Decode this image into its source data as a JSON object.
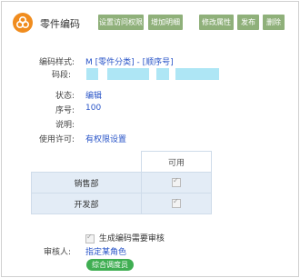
{
  "header": {
    "title": "零件编码",
    "buttons": [
      "设置访问权限",
      "增加明细",
      "修改属性",
      "发布",
      "删除"
    ]
  },
  "form": {
    "code_style_label": "编码样式:",
    "code_style_value": "M [零件分类] - [顺序号]",
    "code_segment_label": "码段:",
    "status_label": "状态:",
    "status_value": "编辑",
    "seq_label": "序号:",
    "seq_value": "100",
    "desc_label": "说明:",
    "license_label": "使用许可:",
    "license_value": "有权限设置"
  },
  "permissions": {
    "column_header": "可用",
    "rows": [
      "销售部",
      "开发部"
    ]
  },
  "review": {
    "checkbox_label": "生成编码需要审核",
    "reviewer_label": "审核人:",
    "reviewer_value": "指定某角色",
    "reviewer_badge": "综合调度员"
  },
  "colors": {
    "accent": "#8fb07a",
    "link": "#2a55c8",
    "highlight": "#aee6f5",
    "badge": "#3fae52",
    "logo": "#f08c1e"
  }
}
